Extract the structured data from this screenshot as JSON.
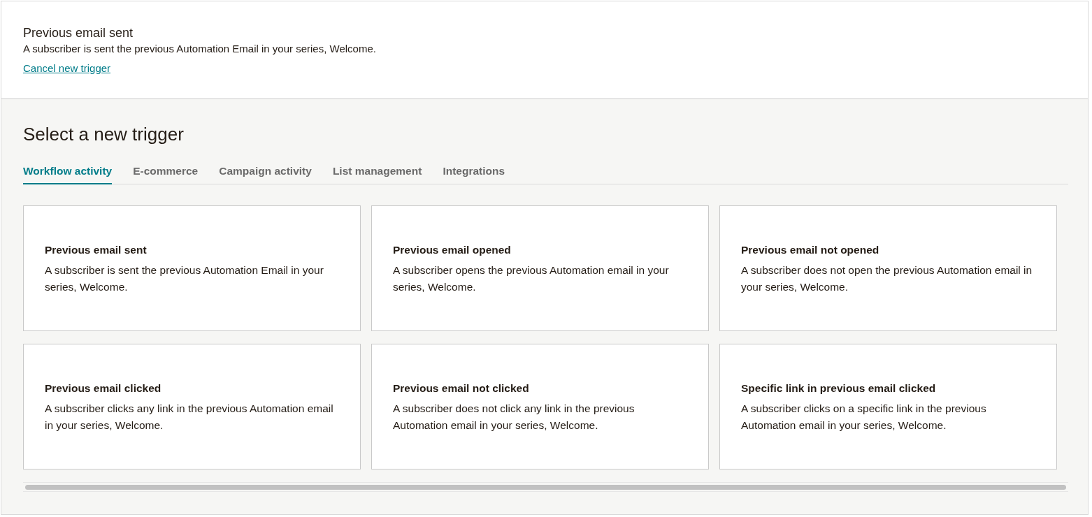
{
  "current_trigger": {
    "title": "Previous email sent",
    "description": "A subscriber is sent the previous Automation Email in your series, Welcome.",
    "cancel_link": "Cancel new trigger"
  },
  "heading": "Select a new trigger",
  "tabs": [
    {
      "label": "Workflow activity",
      "selected": true
    },
    {
      "label": "E-commerce",
      "selected": false
    },
    {
      "label": "Campaign activity",
      "selected": false
    },
    {
      "label": "List management",
      "selected": false
    },
    {
      "label": "Integrations",
      "selected": false
    }
  ],
  "cards": [
    {
      "title": "Previous email sent",
      "description": "A subscriber is sent the previous Automation Email in your series, Welcome."
    },
    {
      "title": "Previous email opened",
      "description": "A subscriber opens the previous Automation email in your series, Welcome."
    },
    {
      "title": "Previous email not opened",
      "description": "A subscriber does not open the previous Automation email in your series, Welcome."
    },
    {
      "title": "Previous email clicked",
      "description": "A subscriber clicks any link in the previous Automation email in your series, Welcome."
    },
    {
      "title": "Previous email not clicked",
      "description": "A subscriber does not click any link in the previous Automation email in your series, Welcome."
    },
    {
      "title": "Specific link in previous email clicked",
      "description": "A subscriber clicks on a specific link in the previous Automation email in your series, Welcome."
    }
  ]
}
